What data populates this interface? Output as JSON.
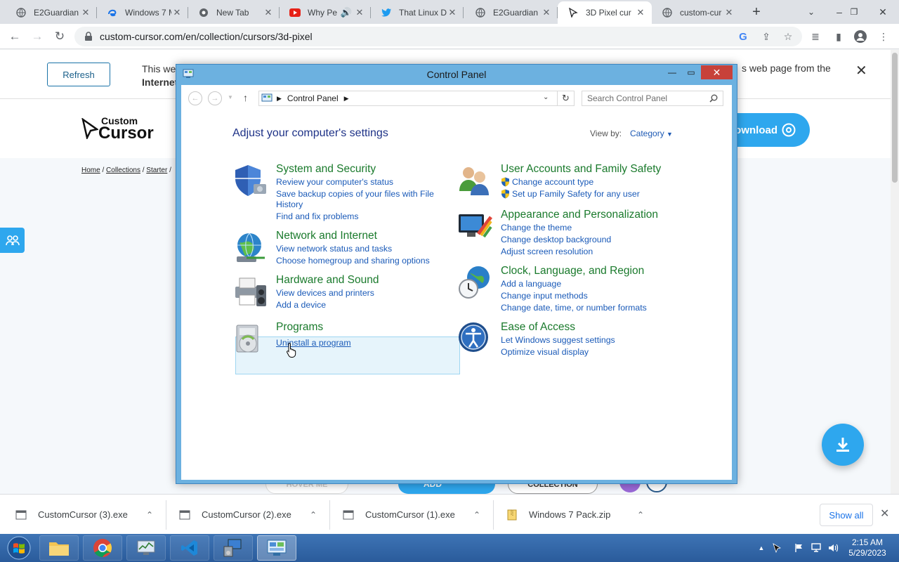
{
  "browser": {
    "tabs": [
      {
        "title": "E2Guardian",
        "icon": "globe-icon"
      },
      {
        "title": "Windows 7 M",
        "icon": "edge-like-icon"
      },
      {
        "title": "New Tab",
        "icon": "chrome-icon"
      },
      {
        "title": "Why Pe",
        "icon": "youtube-icon"
      },
      {
        "title": "That Linux D",
        "icon": "twitter-icon"
      },
      {
        "title": "E2Guardian",
        "icon": "globe-icon"
      },
      {
        "title": "3D Pixel cur",
        "icon": "cursor-icon"
      },
      {
        "title": "custom-cur",
        "icon": "globe-icon"
      }
    ],
    "active_tab": 6,
    "url": "custom-cursor.com/en/collection/cursors/3d-pixel"
  },
  "page": {
    "info_refresh": "Refresh",
    "info_text_line1": "This wel",
    "info_text_line2": "Internet",
    "info_text_right": "s web page from the",
    "logo_top": "Custom",
    "logo_bottom": "Cursor",
    "download_label": "Download",
    "breadcrumb": [
      "Home",
      "Collections",
      "Starter"
    ],
    "peek_left": "HOVER ME",
    "peek_add": "ADD",
    "peek_collection": "COLLECTION"
  },
  "control_panel": {
    "title": "Control Panel",
    "path": "Control Panel",
    "search_placeholder": "Search Control Panel",
    "heading": "Adjust your computer's settings",
    "view_by_label": "View by:",
    "view_by_value": "Category",
    "categories": [
      {
        "title": "System and Security",
        "links": [
          "Review your computer's status",
          "Save backup copies of your files with File",
          "History",
          "Find and fix problems"
        ]
      },
      {
        "title": "Network and Internet",
        "links": [
          "View network status and tasks",
          "Choose homegroup and sharing options"
        ]
      },
      {
        "title": "Hardware and Sound",
        "links": [
          "View devices and printers",
          "Add a device"
        ]
      },
      {
        "title": "Programs",
        "links": [
          "Uninstall a program"
        ]
      },
      {
        "title": "User Accounts and Family Safety",
        "links": [
          "Change account type",
          "Set up Family Safety for any user"
        ]
      },
      {
        "title": "Appearance and Personalization",
        "links": [
          "Change the theme",
          "Change desktop background",
          "Adjust screen resolution"
        ]
      },
      {
        "title": "Clock, Language, and Region",
        "links": [
          "Add a language",
          "Change input methods",
          "Change date, time, or number formats"
        ]
      },
      {
        "title": "Ease of Access",
        "links": [
          "Let Windows suggest settings",
          "Optimize visual display"
        ]
      }
    ]
  },
  "downloads": {
    "items": [
      "CustomCursor (3).exe",
      "CustomCursor (2).exe",
      "CustomCursor (1).exe",
      "Windows 7 Pack.zip"
    ],
    "show_all": "Show all"
  },
  "taskbar": {
    "time": "2:15 AM",
    "date": "5/29/2023"
  },
  "colors": {
    "accent": "#2ea7ee",
    "cp_category": "#1a7a2c",
    "cp_link": "#1a5ab8",
    "cp_heading": "#1e3287"
  }
}
